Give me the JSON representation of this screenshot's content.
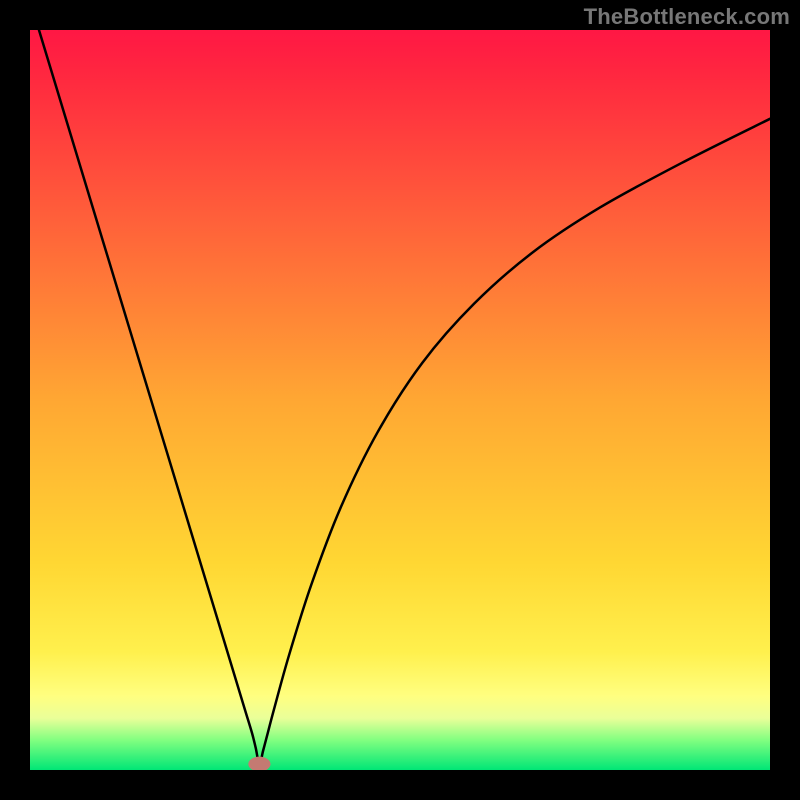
{
  "watermark": "TheBottleneck.com",
  "chart_data": {
    "type": "line",
    "title": "",
    "xlabel": "",
    "ylabel": "",
    "xlim": [
      0,
      100
    ],
    "ylim": [
      0,
      100
    ],
    "grid": false,
    "legend": false,
    "annotations": [],
    "background_gradient": {
      "stops": [
        {
          "offset": 0.0,
          "color": "#ff1744"
        },
        {
          "offset": 0.07,
          "color": "#ff2a3f"
        },
        {
          "offset": 0.5,
          "color": "#ffa733"
        },
        {
          "offset": 0.72,
          "color": "#ffd733"
        },
        {
          "offset": 0.84,
          "color": "#fff04d"
        },
        {
          "offset": 0.9,
          "color": "#ffff80"
        },
        {
          "offset": 0.93,
          "color": "#eaff99"
        },
        {
          "offset": 0.96,
          "color": "#80ff80"
        },
        {
          "offset": 1.0,
          "color": "#00e676"
        }
      ]
    },
    "marker": {
      "x": 31,
      "y": 0.8,
      "color": "#c47a72",
      "rx": 1.5,
      "ry": 1.0
    },
    "series": [
      {
        "name": "curve",
        "color": "#000000",
        "x": [
          0,
          5,
          10,
          15,
          20,
          24,
          27,
          29,
          30,
          30.5,
          31,
          31.5,
          32,
          33,
          35,
          38,
          42,
          47,
          53,
          60,
          68,
          77,
          88,
          100
        ],
        "values": [
          104,
          87.5,
          71,
          54.5,
          38,
          24.8,
          14.9,
          8.3,
          5.0,
          3.0,
          0.8,
          2.6,
          4.5,
          8.3,
          15.5,
          25.0,
          35.5,
          45.7,
          55.0,
          63.0,
          70.0,
          76.0,
          82.0,
          88.0
        ]
      }
    ]
  }
}
